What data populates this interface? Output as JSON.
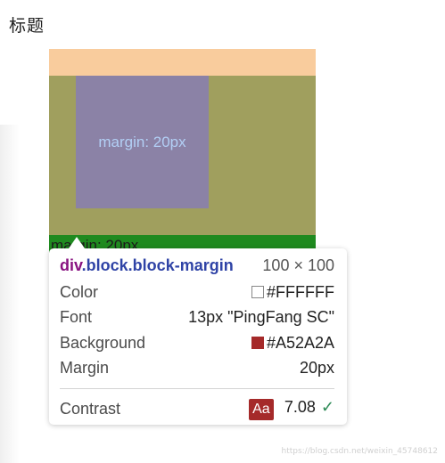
{
  "page": {
    "title": "标题"
  },
  "highlight": {
    "inner_label": "margin: 20px",
    "strip_label": "margin: 20px"
  },
  "tooltip": {
    "tag": "div",
    "classes": ".block.block-margin",
    "dimensions": "100 × 100",
    "rows": [
      {
        "key": "Color",
        "value": "#FFFFFF",
        "swatch": "#FFFFFF"
      },
      {
        "key": "Font",
        "value": "13px \"PingFang SC\""
      },
      {
        "key": "Background",
        "value": "#A52A2A",
        "swatch": "#A52A2A"
      },
      {
        "key": "Margin",
        "value": "20px"
      }
    ],
    "contrast": {
      "key": "Contrast",
      "badge": "Aa",
      "value": "7.08",
      "check": "✓",
      "badge_color": "#A52A2A"
    }
  },
  "watermark": "https://blog.csdn.net/weixin_45748612",
  "colors": {
    "margin_overlay": "#f9cc9d",
    "block_overlay": "#a09f5e",
    "content_overlay": "#8b82a6",
    "strip": "#1f8a1f"
  }
}
